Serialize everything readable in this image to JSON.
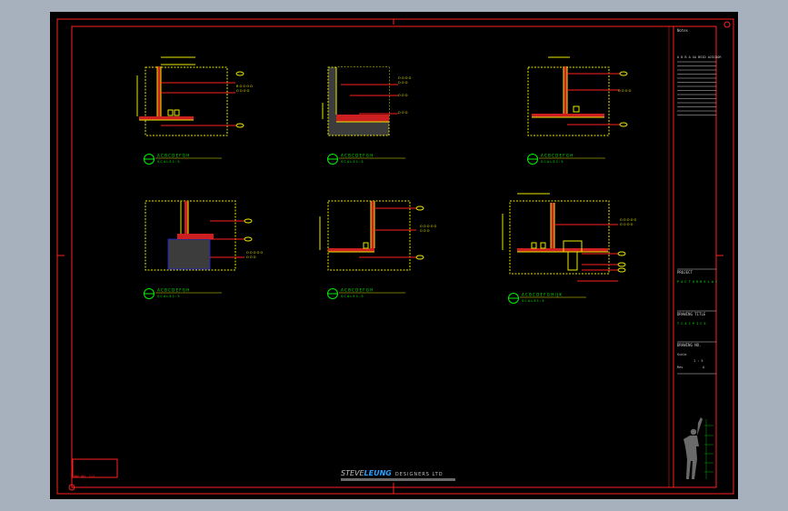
{
  "colors": {
    "background": "#a7b1bd",
    "canvas": "#000000",
    "border": "#ff2020",
    "detail_box": "#e8e800",
    "callout": "#ff2020",
    "label_text": "#e8e800",
    "title_text": "#00ee00",
    "hatch": "#cc2020",
    "fill_gray": "#3c3c3c",
    "fill_blue": "#2020c0",
    "titleblock_text": "#d0d0d0"
  },
  "titleblock": {
    "notes_header": "Notes",
    "table_header": "A B   B A   SA BSID ACSCDOR",
    "project_label": "PROJECT",
    "project_value": "P A C T O R B E L A C",
    "drawing_title_label": "DRAWING TITLE",
    "drawing_title_value": "T C A C P I C E",
    "drawing_no_label": "DRAWING NO.",
    "scale_label": "Scale",
    "scale_value": "1 : 5",
    "rev_label": "Rev",
    "rev_value": "A"
  },
  "logo": {
    "brand_prefix": "STEVE",
    "brand_name": "LEUNG",
    "brand_suffix": "DESIGNERS LTD"
  },
  "details": [
    {
      "title": "A C B C D E F G H",
      "sub": "S C A L E  1 : 5"
    },
    {
      "title": "A C B C D E F G H",
      "sub": "S C A L E  1 : 5"
    },
    {
      "title": "A C B C D E F G H",
      "sub": "S C A L E  1 : 5"
    },
    {
      "title": "A C B C D E F G H",
      "sub": "S C A L E  1 : 5"
    },
    {
      "title": "A C B C D E F G H",
      "sub": "S C A L E  1 : 5"
    },
    {
      "title": "A C B C D E F G H I J K",
      "sub": "S C A L E  1 : 5"
    }
  ],
  "stamp_text": "DWG NO. 1/1"
}
